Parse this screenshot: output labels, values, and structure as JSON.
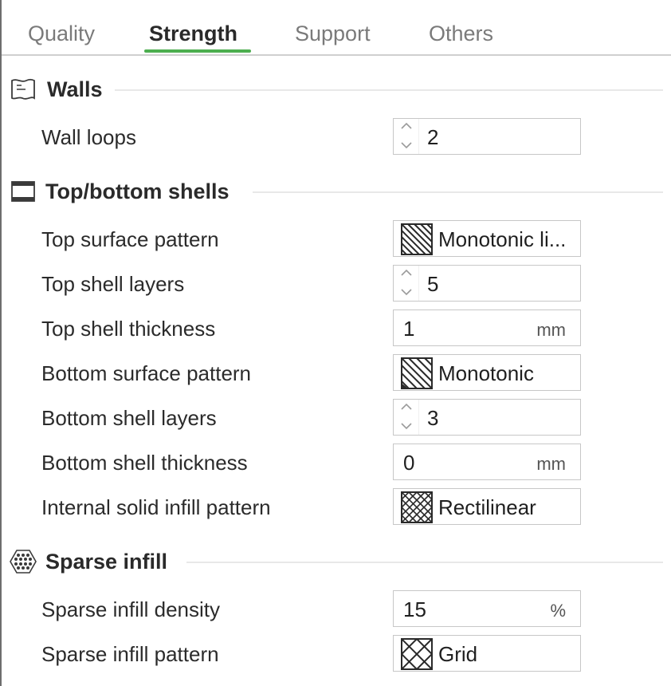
{
  "tabs": [
    {
      "label": "Quality"
    },
    {
      "label": "Strength"
    },
    {
      "label": "Support"
    },
    {
      "label": "Others"
    }
  ],
  "active_tab": "Strength",
  "accent_color": "#4cae4f",
  "sections": {
    "walls": {
      "title": "Walls",
      "icon": "walls-icon",
      "wall_loops": {
        "label": "Wall loops",
        "value": "2"
      }
    },
    "shells": {
      "title": "Top/bottom shells",
      "icon": "top-bottom-shells-icon",
      "top_surface_pattern": {
        "label": "Top surface pattern",
        "value": "Monotonic li...",
        "icon": "monotonic-line-pattern-icon"
      },
      "top_shell_layers": {
        "label": "Top shell layers",
        "value": "5"
      },
      "top_shell_thickness": {
        "label": "Top shell thickness",
        "value": "1",
        "unit": "mm"
      },
      "bottom_surface_pattern": {
        "label": "Bottom surface pattern",
        "value": "Monotonic",
        "icon": "monotonic-pattern-icon"
      },
      "bottom_shell_layers": {
        "label": "Bottom shell layers",
        "value": "3"
      },
      "bottom_shell_thickness": {
        "label": "Bottom shell thickness",
        "value": "0",
        "unit": "mm"
      },
      "internal_solid_infill_pattern": {
        "label": "Internal solid infill pattern",
        "value": "Rectilinear",
        "icon": "rectilinear-pattern-icon"
      }
    },
    "infill": {
      "title": "Sparse infill",
      "icon": "sparse-infill-icon",
      "sparse_infill_density": {
        "label": "Sparse infill density",
        "value": "15",
        "unit": "%"
      },
      "sparse_infill_pattern": {
        "label": "Sparse infill pattern",
        "value": "Grid",
        "icon": "grid-pattern-icon"
      }
    }
  }
}
